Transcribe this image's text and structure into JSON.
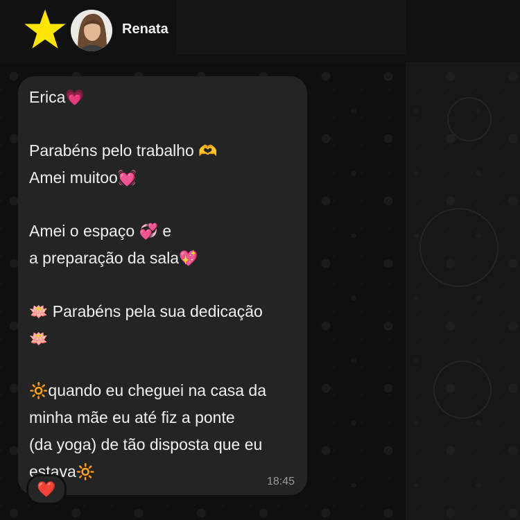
{
  "header": {
    "contact_name": "Renata",
    "star_icon": "star-icon",
    "avatar_icon": "avatar"
  },
  "message": {
    "lines": [
      {
        "text": "Erica",
        "emoji": "💗"
      },
      {
        "text": "Parabéns pelo trabalho",
        "emoji": "🫶"
      },
      {
        "text": "Amei muitoo",
        "emoji": "💓"
      },
      {
        "text": "Amei o espaço",
        "emoji": "💞",
        "suffix": "e"
      },
      {
        "text": "a preparação da sala",
        "emoji": "💖"
      },
      {
        "prefix_emoji": "🪷",
        "text": "Parabéns pela sua dedicação"
      },
      {
        "prefix_emoji": "🪷",
        "text": ""
      },
      {
        "prefix_emoji": "🔆",
        "text": "quando eu cheguei na casa da"
      },
      {
        "text": "minha mãe eu até fiz a ponte"
      },
      {
        "text": "(da yoga) de tão disposta que eu"
      },
      {
        "text": "estava",
        "emoji": "🔆"
      }
    ],
    "timestamp": "18:45",
    "reaction": "❤️"
  },
  "colors": {
    "accent_star": "#ffe600",
    "bubble_bg": "#242424",
    "text": "#f1f1f1",
    "timestamp": "#9a9a9a"
  }
}
